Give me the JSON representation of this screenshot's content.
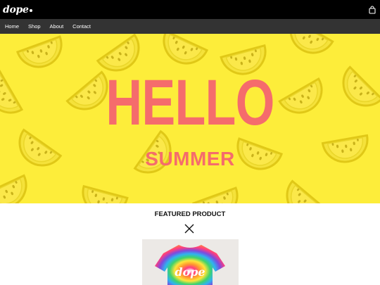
{
  "header": {
    "logo_text": "dope",
    "cart_icon": "shopping-bag-icon"
  },
  "nav": {
    "items": [
      {
        "label": "Home"
      },
      {
        "label": "Shop"
      },
      {
        "label": "About"
      },
      {
        "label": "Contact"
      }
    ]
  },
  "hero": {
    "title": "HELLO",
    "subtitle": "SUMMER",
    "background_color": "#fded3a",
    "text_color": "#f56c6c",
    "pattern": "watermelon-slice-pattern"
  },
  "featured": {
    "heading": "FEATURED PRODUCT",
    "close_icon": "close-icon",
    "product_image_text": "dope"
  }
}
